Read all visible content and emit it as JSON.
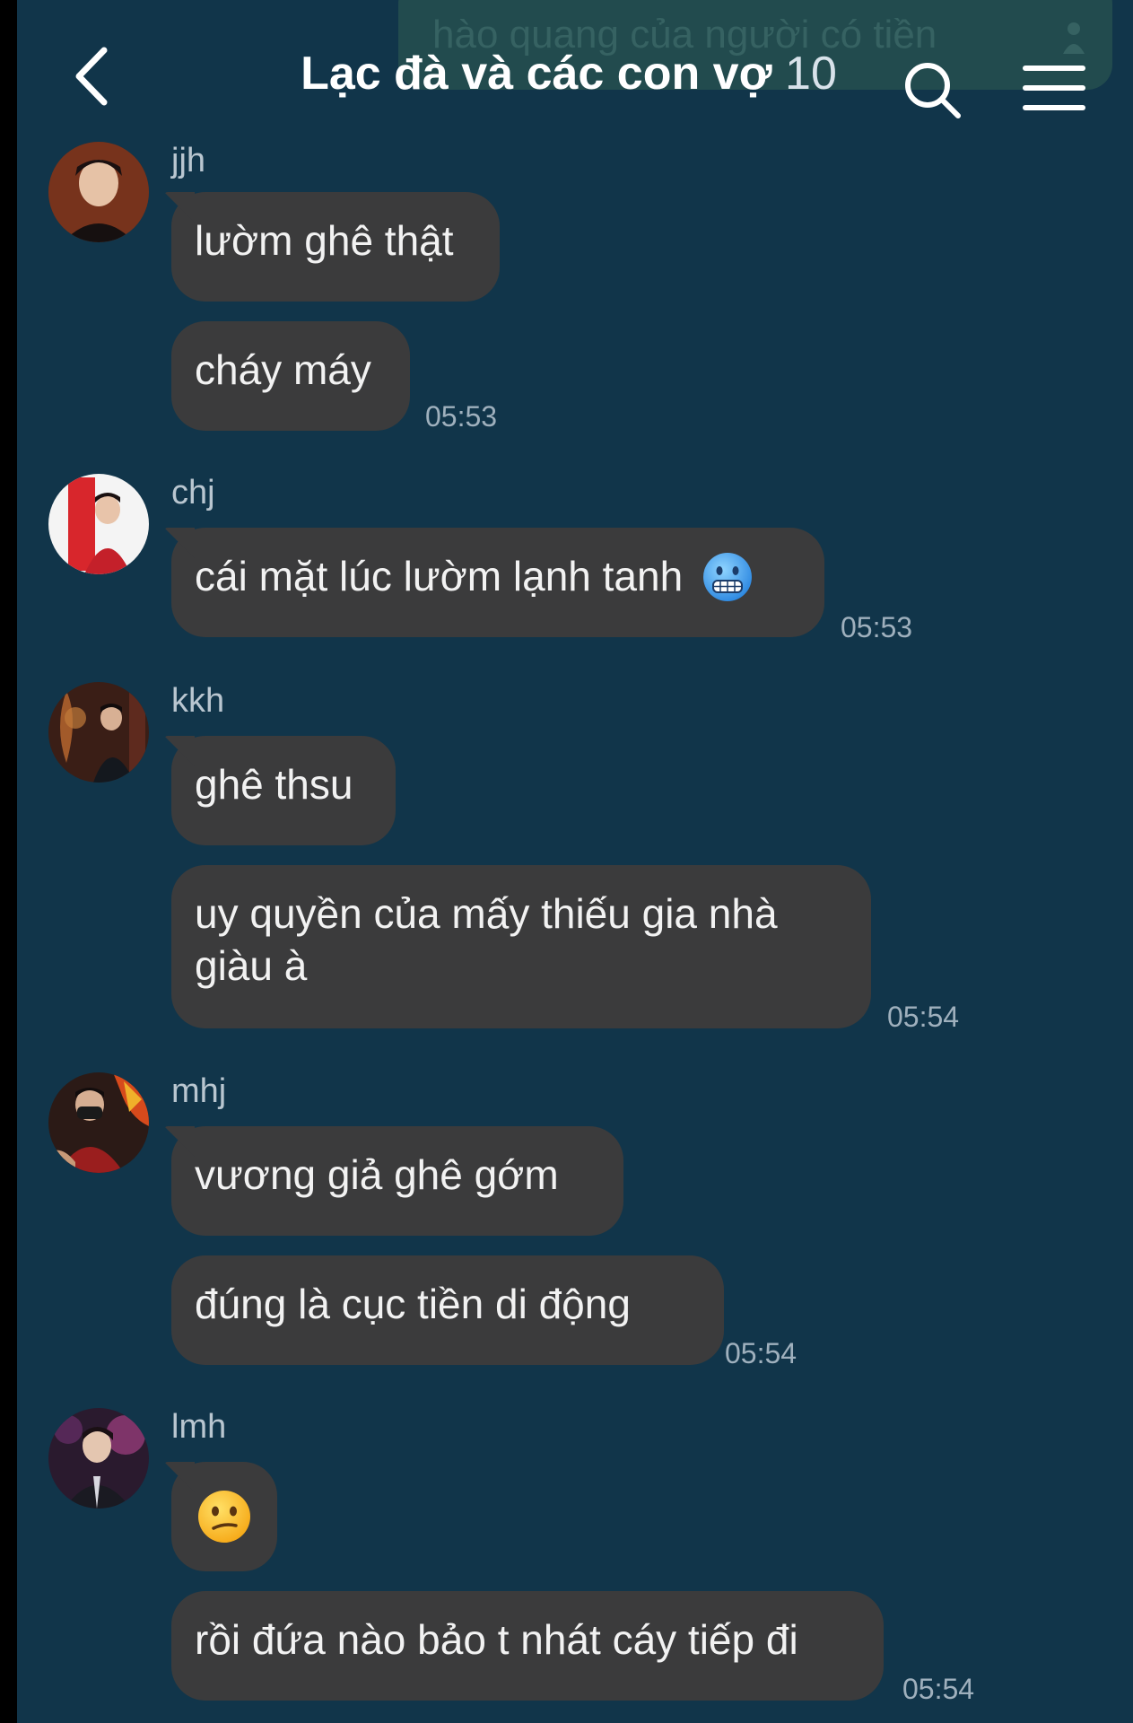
{
  "header": {
    "ghost_preview": "hào quang của người có tiền",
    "title": "Lạc đà và các con vợ",
    "member_count": "10"
  },
  "colors": {
    "background": "#11354a",
    "bubble": "#3b3b3c",
    "text": "#f2f2f2",
    "sender": "#b9c6d0",
    "time": "#9fb0bd"
  },
  "icons": {
    "back": "chevron-left-icon",
    "search": "search-icon",
    "menu": "hamburger-menu-icon"
  },
  "messages": [
    {
      "sender": "jjh",
      "bubbles": [
        {
          "text": "lườm ghê thật"
        },
        {
          "text": "cháy máy"
        }
      ],
      "time": "05:53"
    },
    {
      "sender": "chj",
      "bubbles": [
        {
          "text": "cái mặt lúc lườm lạnh tanh",
          "emoji": "cold-face-emoji"
        }
      ],
      "time": "05:53"
    },
    {
      "sender": "kkh",
      "bubbles": [
        {
          "text": "ghê thsu"
        },
        {
          "text": "uy quyền của mấy thiếu gia nhà giàu à"
        }
      ],
      "time": "05:54"
    },
    {
      "sender": "mhj",
      "bubbles": [
        {
          "text": "vương giả ghê gớm"
        },
        {
          "text": "đúng là cục tiền di động"
        }
      ],
      "time": "05:54"
    },
    {
      "sender": "lmh",
      "bubbles": [
        {
          "emoji": "confused-face-emoji"
        },
        {
          "text": "rồi đứa nào bảo t nhát cáy tiếp đi"
        }
      ],
      "time": "05:54"
    }
  ]
}
